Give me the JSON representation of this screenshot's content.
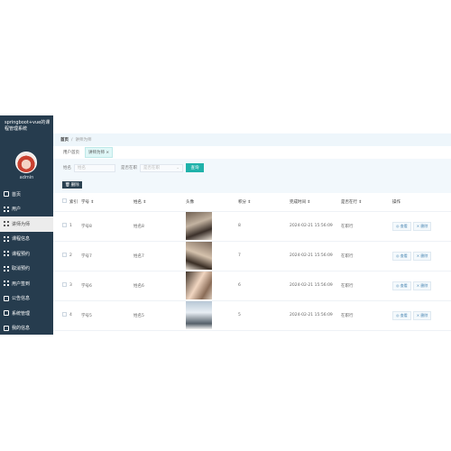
{
  "app": {
    "brand": "springboot+vue的课程管理系统",
    "username": "admin"
  },
  "sidebar": {
    "items": [
      {
        "label": "首页",
        "icon": "home-icon"
      },
      {
        "label": "用户",
        "icon": "grid-icon"
      },
      {
        "label": "讲师为师",
        "icon": "grid-icon"
      },
      {
        "label": "课程信息",
        "icon": "grid-icon"
      },
      {
        "label": "课程预约",
        "icon": "grid-icon"
      },
      {
        "label": "取消预约",
        "icon": "grid-icon"
      },
      {
        "label": "用户签到",
        "icon": "grid-icon"
      },
      {
        "label": "公告信息",
        "icon": "sliders-icon"
      },
      {
        "label": "系统管理",
        "icon": "user-icon"
      },
      {
        "label": "我的信息",
        "icon": "card-icon"
      }
    ]
  },
  "breadcrumb": {
    "home": "首页",
    "sep": "/",
    "current": "讲师为师"
  },
  "tabs": [
    {
      "label": "用户首页"
    },
    {
      "label": "讲师为师 ×"
    }
  ],
  "filters": {
    "name_label": "姓名",
    "name_placeholder": "姓名",
    "status_label": "是否在职",
    "status_placeholder": "是否在职",
    "search_label": "查询"
  },
  "toolbar": {
    "delete_label": "删除"
  },
  "table": {
    "headers": [
      "索引",
      "学号 ⇕",
      "姓名 ⇕",
      "头像",
      "积分 ⇕",
      "完成时间 ⇕",
      "是否在行 ⇕",
      "操作"
    ],
    "rows": [
      {
        "index": "1",
        "student_id": "学号8",
        "name": "姓名8",
        "score": "8",
        "time": "2024-02-21 15:56:09",
        "status": "在职行"
      },
      {
        "index": "2",
        "student_id": "学号7",
        "name": "姓名7",
        "score": "7",
        "time": "2024-02-21 15:56:09",
        "status": "在职行"
      },
      {
        "index": "3",
        "student_id": "学号6",
        "name": "姓名6",
        "score": "6",
        "time": "2024-02-21 15:56:09",
        "status": "在职行"
      },
      {
        "index": "4",
        "student_id": "学号5",
        "name": "姓名5",
        "score": "5",
        "time": "2024-02-21 15:56:09",
        "status": "在职行"
      }
    ],
    "view_label": "◎ 查看",
    "delete_label": "× 删除"
  }
}
